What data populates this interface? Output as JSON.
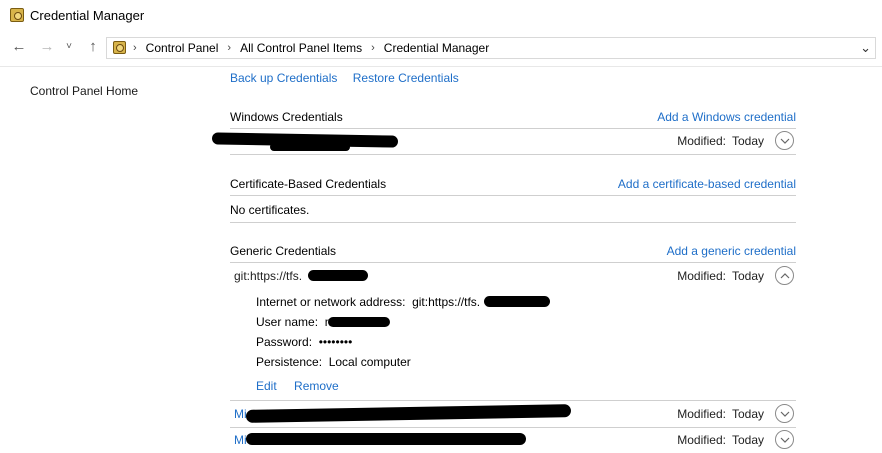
{
  "window": {
    "title": "Credential Manager"
  },
  "address_bar": {
    "crumbs": [
      "Control Panel",
      "All Control Panel Items",
      "Credential Manager"
    ]
  },
  "left_pane": {
    "home_link": "Control Panel Home"
  },
  "top_links": {
    "backup": "Back up Credentials",
    "restore": "Restore Credentials"
  },
  "windows_credentials": {
    "title": "Windows Credentials",
    "add_label": "Add a Windows credential",
    "entries": [
      {
        "modified_label": "Modified:",
        "modified_value": "Today"
      }
    ]
  },
  "certificate_credentials": {
    "title": "Certificate-Based Credentials",
    "add_label": "Add a certificate-based credential",
    "empty_text": "No certificates."
  },
  "generic_credentials": {
    "title": "Generic Credentials",
    "add_label": "Add a generic credential",
    "expanded": {
      "name": "git:https://tfs.",
      "modified_label": "Modified:",
      "modified_value": "Today",
      "address_label": "Internet or network address:",
      "address_value": "git:https://tfs.",
      "username_label": "User name:",
      "username_value": "n",
      "password_label": "Password:",
      "password_value": "••••••••",
      "persistence_label": "Persistence:",
      "persistence_value": "Local computer",
      "edit_label": "Edit",
      "remove_label": "Remove"
    },
    "entries": [
      {
        "name": "Mi",
        "modified_label": "Modified:",
        "modified_value": "Today"
      },
      {
        "name": "Mi",
        "modified_label": "Modified:",
        "modified_value": "Today"
      }
    ]
  },
  "icons": [
    "credential-manager-icon",
    "back-arrow-icon",
    "forward-arrow-icon",
    "recent-dropdown-icon",
    "up-arrow-icon",
    "chevron-down-icon",
    "chevron-up-icon"
  ]
}
